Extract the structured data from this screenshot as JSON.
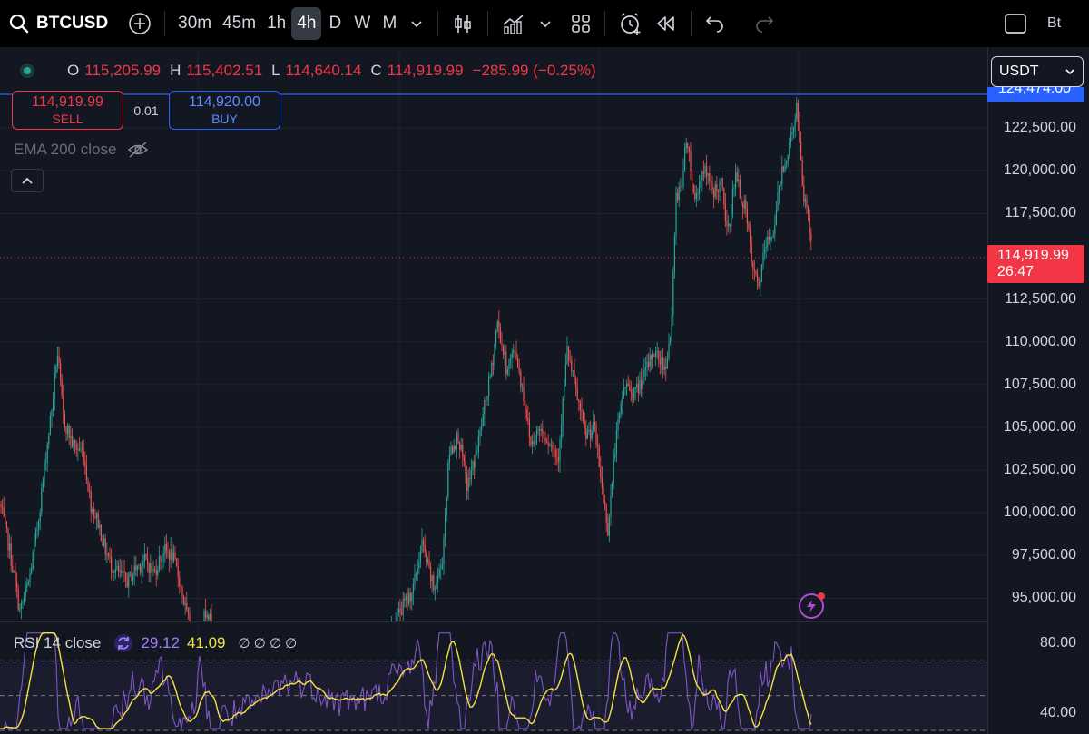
{
  "toolbar": {
    "symbol": "BTCUSD",
    "intervals": [
      "30m",
      "45m",
      "1h",
      "4h",
      "D",
      "W",
      "M"
    ],
    "active_interval": "4h",
    "right_label": "Bt"
  },
  "legend": {
    "open_key": "O",
    "open": "115,205.99",
    "high_key": "H",
    "high": "115,402.51",
    "low_key": "L",
    "low": "114,640.14",
    "close_key": "C",
    "close": "114,919.99",
    "change": "−285.99 (−0.25%)"
  },
  "trade": {
    "sell_price": "114,919.99",
    "sell_label": "SELL",
    "quantity": "0.01",
    "buy_price": "114,920.00",
    "buy_label": "BUY"
  },
  "indicators": {
    "ema_label": "EMA 200 close",
    "rsi_label": "RSI 14 close",
    "rsi_value": "29.12",
    "rsi_ma_value": "41.09",
    "rsi_extra": "∅ ∅ ∅ ∅"
  },
  "price_axis": {
    "currency": "USDT",
    "ticks": [
      "122,500.00",
      "120,000.00",
      "117,500.00",
      "112,500.00",
      "110,000.00",
      "107,500.00",
      "105,000.00",
      "102,500.00",
      "100,000.00",
      "97,500.00",
      "95,000.00"
    ],
    "rsi_ticks": [
      "80.00",
      "40.00"
    ],
    "high_label": "124,474.00",
    "last_price": "114,919.99",
    "countdown": "26:47"
  },
  "chart_data": {
    "type": "candlestick",
    "y_range": [
      93700,
      124474
    ],
    "current_price": 114919.99,
    "high_marker": 124474,
    "up_color": "#26a69a",
    "down_color": "#ef5350",
    "path_anchors": [
      [
        0,
        100500
      ],
      [
        10,
        98000
      ],
      [
        22,
        94200
      ],
      [
        32,
        96000
      ],
      [
        42,
        99500
      ],
      [
        52,
        104000
      ],
      [
        58,
        106500
      ],
      [
        63,
        109500
      ],
      [
        70,
        105500
      ],
      [
        80,
        104000
      ],
      [
        92,
        103500
      ],
      [
        100,
        100500
      ],
      [
        108,
        99500
      ],
      [
        115,
        98000
      ],
      [
        122,
        97000
      ],
      [
        130,
        96500
      ],
      [
        140,
        96000
      ],
      [
        150,
        96800
      ],
      [
        160,
        97200
      ],
      [
        170,
        96500
      ],
      [
        180,
        97800
      ],
      [
        190,
        97500
      ],
      [
        198,
        96000
      ],
      [
        205,
        94200
      ],
      [
        215,
        92000
      ],
      [
        228,
        94500
      ],
      [
        240,
        91500
      ],
      [
        300,
        90000
      ],
      [
        380,
        90000
      ],
      [
        425,
        92500
      ],
      [
        440,
        94200
      ],
      [
        455,
        95500
      ],
      [
        465,
        98200
      ],
      [
        478,
        95500
      ],
      [
        487,
        97000
      ],
      [
        495,
        103500
      ],
      [
        505,
        104500
      ],
      [
        515,
        101500
      ],
      [
        525,
        103500
      ],
      [
        535,
        106500
      ],
      [
        542,
        108500
      ],
      [
        548,
        111200
      ],
      [
        558,
        108500
      ],
      [
        568,
        109500
      ],
      [
        578,
        106500
      ],
      [
        585,
        104000
      ],
      [
        595,
        105000
      ],
      [
        605,
        104200
      ],
      [
        615,
        103200
      ],
      [
        625,
        109500
      ],
      [
        635,
        107000
      ],
      [
        645,
        104500
      ],
      [
        655,
        105000
      ],
      [
        662,
        102000
      ],
      [
        670,
        99000
      ],
      [
        678,
        104000
      ],
      [
        688,
        107500
      ],
      [
        700,
        107000
      ],
      [
        710,
        108000
      ],
      [
        720,
        109500
      ],
      [
        733,
        108500
      ],
      [
        740,
        111000
      ],
      [
        745,
        118500
      ],
      [
        752,
        119500
      ],
      [
        757,
        122200
      ],
      [
        765,
        118200
      ],
      [
        775,
        120200
      ],
      [
        785,
        118800
      ],
      [
        795,
        119200
      ],
      [
        802,
        116200
      ],
      [
        810,
        119800
      ],
      [
        822,
        117500
      ],
      [
        830,
        114000
      ],
      [
        836,
        113200
      ],
      [
        843,
        115500
      ],
      [
        852,
        116500
      ],
      [
        862,
        120200
      ],
      [
        869,
        121200
      ],
      [
        878,
        123800
      ],
      [
        885,
        118500
      ],
      [
        890,
        117800
      ],
      [
        895,
        114920
      ]
    ],
    "rsi_range": [
      30,
      90
    ],
    "rsi_levels": [
      70,
      50,
      30
    ]
  }
}
